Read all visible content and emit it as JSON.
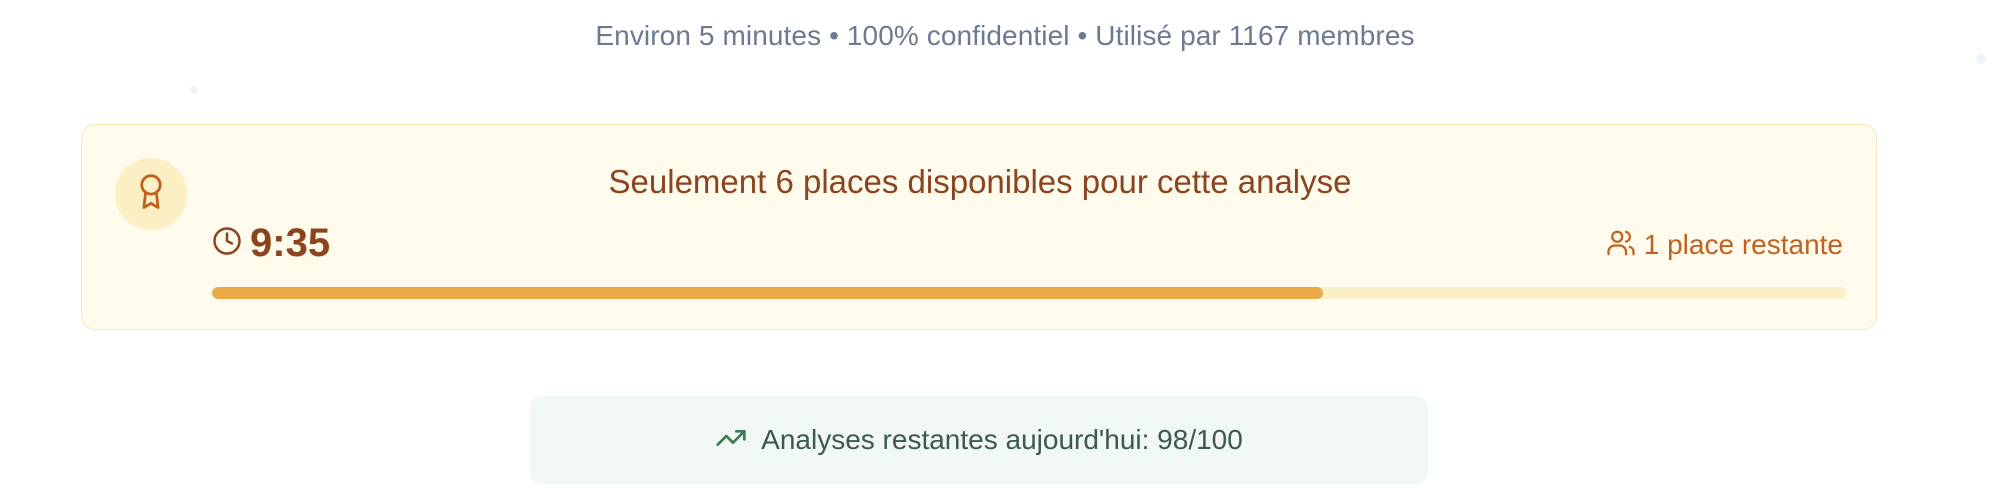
{
  "header": {
    "subtitle": "Environ 5 minutes • 100% confidentiel • Utilisé par 1167 membres"
  },
  "promo": {
    "headline": "Seulement 6 places disponibles pour cette analyse",
    "timer": "9:35",
    "spots_left": "1 place restante",
    "progress_fraction": 0.68,
    "badge_icon": "award-icon",
    "timer_icon": "clock-icon",
    "spots_icon": "users-icon"
  },
  "quota": {
    "label": "Analyses restantes aujourd'hui: 98/100",
    "icon": "trending-up-icon"
  },
  "colors": {
    "accent": "#ebaa4a",
    "headline": "#8a4520",
    "spots": "#c0621f",
    "card_bg": "#fefaec",
    "quota_bg": "#f1f7f3"
  }
}
